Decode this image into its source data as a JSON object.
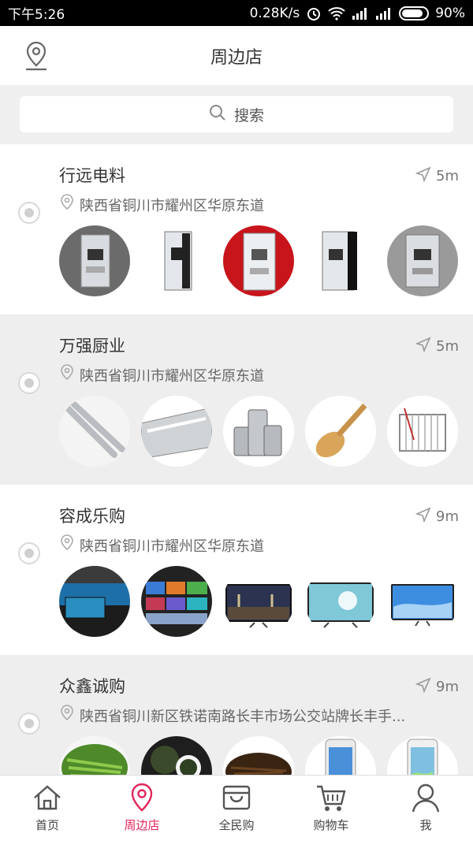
{
  "statusbar": {
    "time": "下午5:26",
    "speed": "0.28K/s",
    "battery": "90%"
  },
  "header": {
    "title": "周边店",
    "location_icon": "map-pin-icon"
  },
  "search": {
    "placeholder": "搜索",
    "icon": "search-icon"
  },
  "stores": [
    {
      "name": "行远电料",
      "distance": "5m",
      "address": "陕西省铜川市耀州区华原东道",
      "thumbs": [
        "circuit-breaker",
        "circuit-breaker",
        "circuit-breaker-red",
        "circuit-breaker",
        "circuit-breaker"
      ]
    },
    {
      "name": "万强厨业",
      "distance": "5m",
      "address": "陕西省铜川市耀州区华原东道",
      "thumbs": [
        "steel-tongs",
        "steel-tray",
        "spice-jars",
        "wooden-spoon",
        "dish-rack"
      ]
    },
    {
      "name": "容成乐购",
      "distance": "9m",
      "address": "陕西省铜川市耀州区华原东道",
      "thumbs": [
        "fish-tank",
        "tv-display-wall",
        "tv-bridge",
        "tv-dandelion",
        "tv-sky"
      ]
    },
    {
      "name": "众鑫诚购",
      "distance": "9m",
      "address": "陕西省铜川新区铁诺南路长丰市场公交站牌长丰手...",
      "thumbs": [
        "green-tea",
        "tea-leaves",
        "black-tea",
        "iphone-white",
        "iphone-screen"
      ]
    }
  ],
  "tabs": [
    {
      "label": "首页",
      "icon": "home-icon",
      "active": false
    },
    {
      "label": "周边店",
      "icon": "location-pin-icon",
      "active": true
    },
    {
      "label": "全民购",
      "icon": "shopping-bag-icon",
      "active": false
    },
    {
      "label": "购物车",
      "icon": "cart-icon",
      "active": false
    },
    {
      "label": "我",
      "icon": "user-icon",
      "active": false
    }
  ],
  "colors": {
    "accent": "#e4245a",
    "alt_row": "#efeeef"
  }
}
